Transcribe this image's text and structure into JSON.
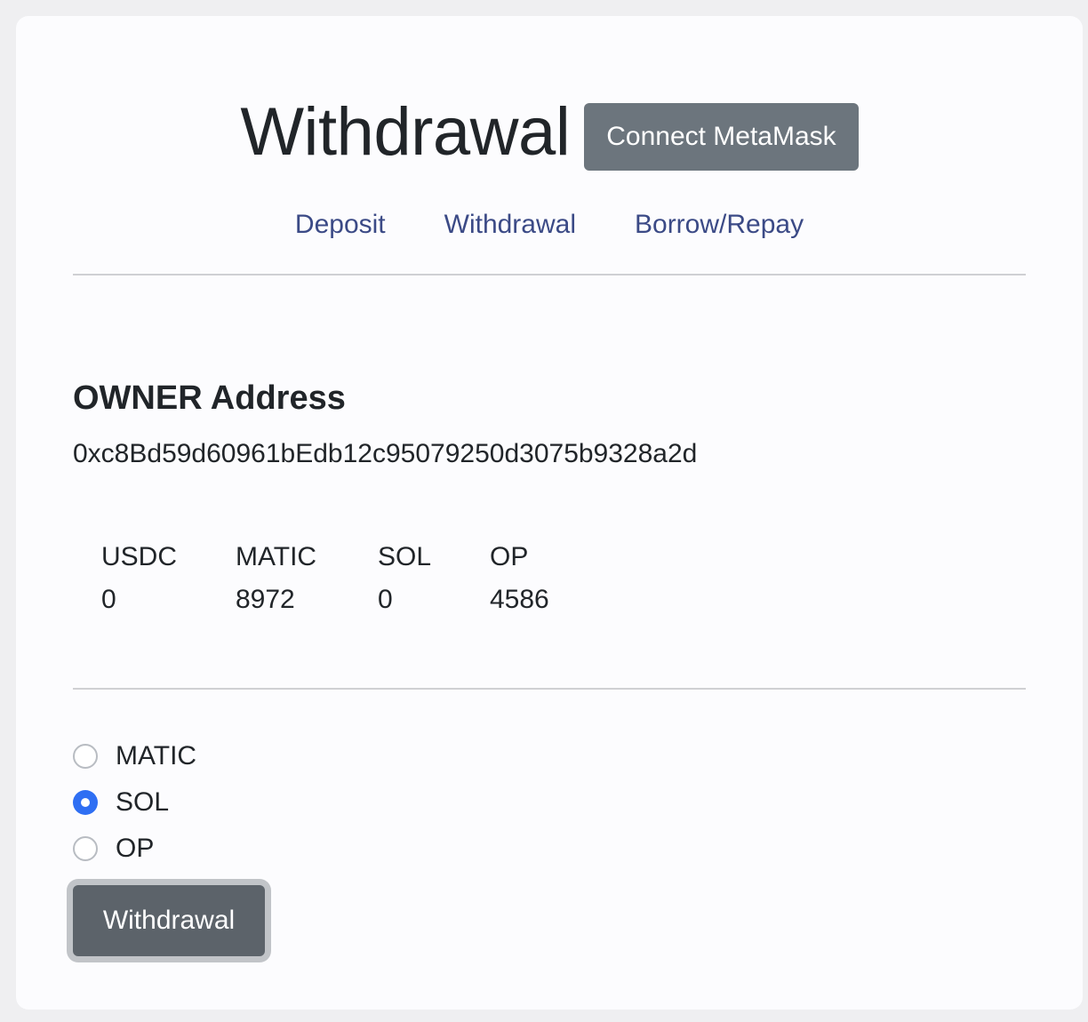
{
  "header": {
    "title": "Withdrawal",
    "connect_label": "Connect MetaMask"
  },
  "nav": [
    {
      "label": "Deposit"
    },
    {
      "label": "Withdrawal"
    },
    {
      "label": "Borrow/Repay"
    }
  ],
  "owner": {
    "heading": "OWNER Address",
    "address": "0xc8Bd59d60961bEdb12c95079250d3075b9328a2d"
  },
  "balances": [
    {
      "token": "USDC",
      "amount": "0"
    },
    {
      "token": "MATIC",
      "amount": "8972"
    },
    {
      "token": "SOL",
      "amount": "0"
    },
    {
      "token": "OP",
      "amount": "4586"
    }
  ],
  "token_options": [
    {
      "label": "MATIC",
      "checked": false
    },
    {
      "label": "SOL",
      "checked": true
    },
    {
      "label": "OP",
      "checked": false
    }
  ],
  "withdraw_button": {
    "label": "Withdrawal"
  },
  "colors": {
    "accent": "#2f6ff3",
    "link": "#3b4a86",
    "button_secondary": "#6c757d",
    "button_pressed": "#5c636a"
  }
}
